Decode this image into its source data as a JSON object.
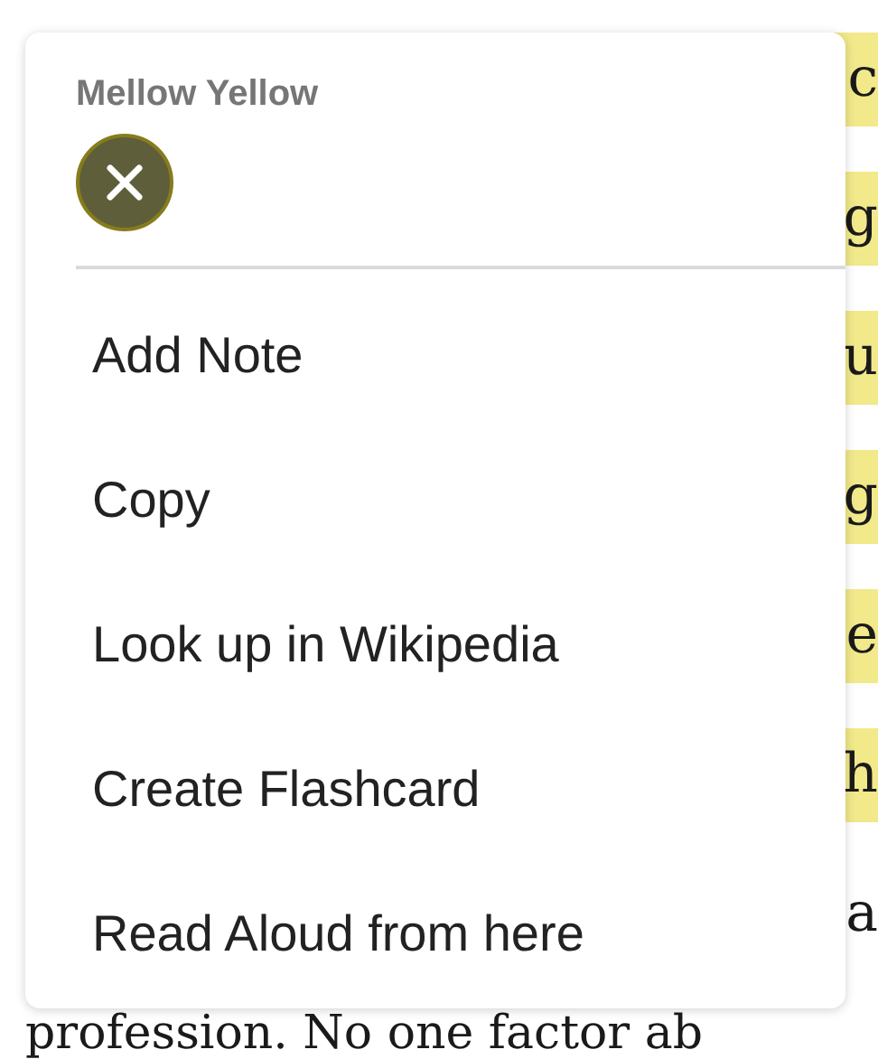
{
  "background_text": {
    "lines": [
      {
        "text": "c",
        "highlighted": true
      },
      {
        "text": "g",
        "highlighted": true
      },
      {
        "text": "u",
        "highlighted": true
      },
      {
        "text": "g",
        "highlighted": true
      },
      {
        "text": "e",
        "highlighted": true
      },
      {
        "text": "h",
        "highlighted": true
      },
      {
        "text": "a",
        "highlighted": false
      }
    ],
    "last_line": "profession. No one factor ab"
  },
  "menu": {
    "title": "Mellow Yellow",
    "items": [
      {
        "label": "Add Note"
      },
      {
        "label": "Copy"
      },
      {
        "label": "Look up in Wikipedia"
      },
      {
        "label": "Create Flashcard"
      },
      {
        "label": "Read Aloud from here"
      }
    ]
  }
}
